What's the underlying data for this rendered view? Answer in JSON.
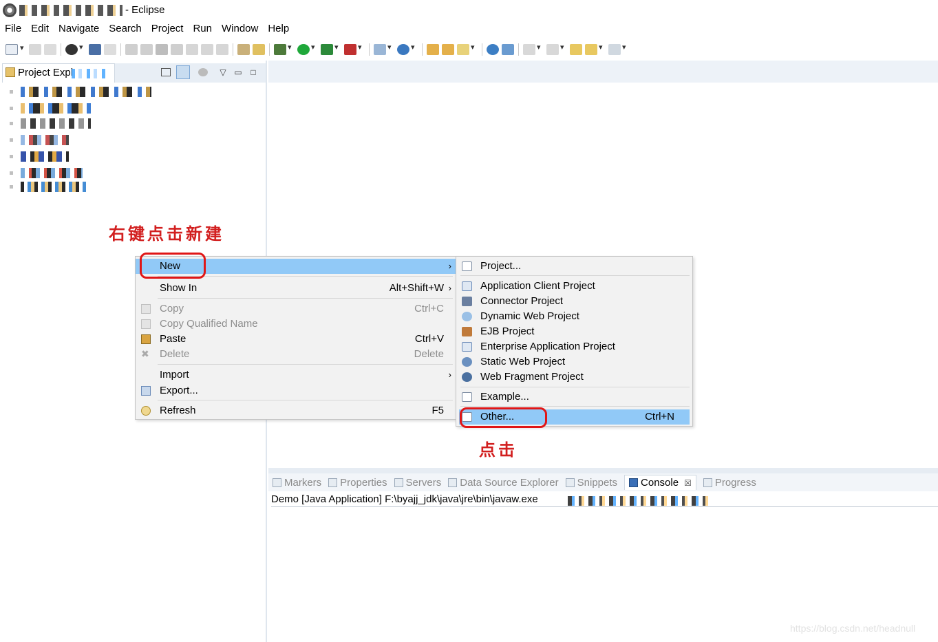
{
  "window": {
    "title": "- Eclipse"
  },
  "menubar": [
    "File",
    "Edit",
    "Navigate",
    "Search",
    "Project",
    "Run",
    "Window",
    "Help"
  ],
  "project_explorer": {
    "tab_title": "Project Expl"
  },
  "annotations": {
    "right_click_new": "右键点击新建",
    "click": "点击"
  },
  "context_menu": {
    "items": [
      {
        "label": "New",
        "shortcut": "",
        "arrow": "›"
      },
      {
        "label": "Show In",
        "shortcut": "Alt+Shift+W",
        "arrow": "›"
      },
      {
        "label": "Copy",
        "shortcut": "Ctrl+C",
        "arrow": ""
      },
      {
        "label": "Copy Qualified Name",
        "shortcut": "",
        "arrow": ""
      },
      {
        "label": "Paste",
        "shortcut": "Ctrl+V",
        "arrow": ""
      },
      {
        "label": "Delete",
        "shortcut": "Delete",
        "arrow": ""
      },
      {
        "label": "Import",
        "shortcut": "",
        "arrow": "›"
      },
      {
        "label": "Export...",
        "shortcut": "",
        "arrow": ""
      },
      {
        "label": "Refresh",
        "shortcut": "F5",
        "arrow": ""
      }
    ]
  },
  "new_submenu": {
    "items": [
      {
        "label": "Project...",
        "shortcut": ""
      },
      {
        "label": "Application Client Project",
        "shortcut": ""
      },
      {
        "label": "Connector Project",
        "shortcut": ""
      },
      {
        "label": "Dynamic Web Project",
        "shortcut": ""
      },
      {
        "label": "EJB Project",
        "shortcut": ""
      },
      {
        "label": "Enterprise Application Project",
        "shortcut": ""
      },
      {
        "label": "Static Web Project",
        "shortcut": ""
      },
      {
        "label": "Web Fragment Project",
        "shortcut": ""
      },
      {
        "label": "Example...",
        "shortcut": ""
      },
      {
        "label": "Other...",
        "shortcut": "Ctrl+N"
      }
    ]
  },
  "console": {
    "tabs": [
      {
        "label": "Markers"
      },
      {
        "label": "Properties"
      },
      {
        "label": "Servers"
      },
      {
        "label": "Data Source Explorer"
      },
      {
        "label": "Snippets"
      },
      {
        "label": "Console",
        "close": "☒"
      },
      {
        "label": "Progress"
      }
    ],
    "line": "Demo [Java Application] F:\\byajj_jdk\\java\\jre\\bin\\javaw.exe"
  },
  "watermark": "https://blog.csdn.net/headnull",
  "colors": {
    "highlight": "#91c9f7",
    "annotation_red": "#d21f1f",
    "ring_red": "#e01616"
  }
}
